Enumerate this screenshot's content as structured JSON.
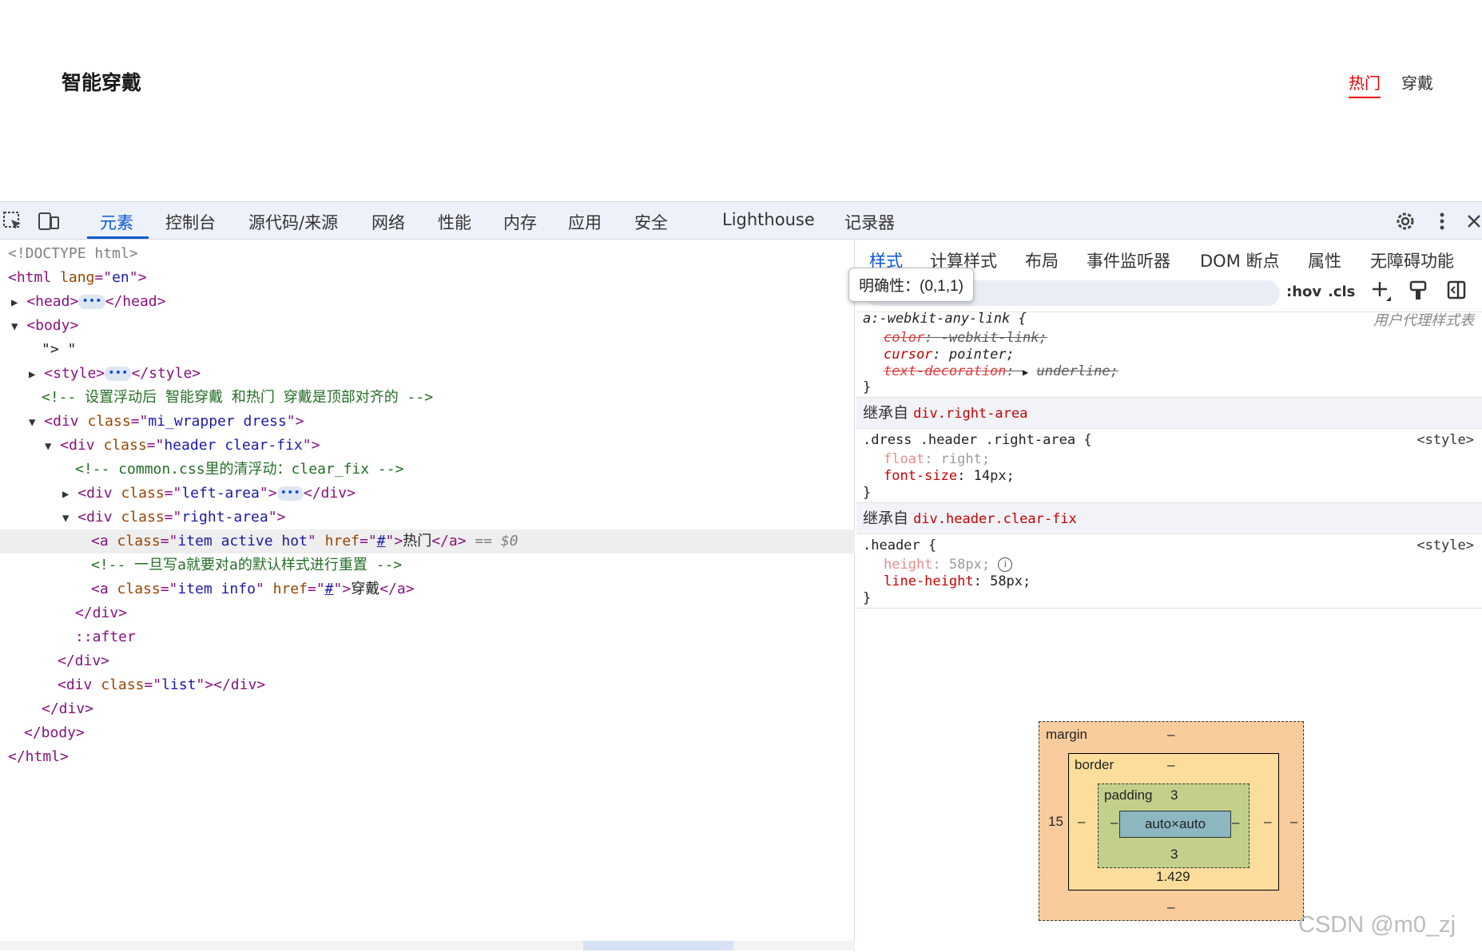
{
  "page": {
    "title": "智能穿戴",
    "nav": [
      "热门",
      "穿戴"
    ]
  },
  "devtools": {
    "tabs": [
      "元素",
      "控制台",
      "源代码/来源",
      "网络",
      "性能",
      "内存",
      "应用",
      "安全",
      "Lighthouse",
      "记录器"
    ],
    "active_tab": "元素",
    "icons": [
      "inspect-icon",
      "device-toolbar-icon",
      "gear-icon",
      "more-vert-icon",
      "close-icon"
    ]
  },
  "elements": {
    "lines": {
      "l1": "<!DOCTYPE html>",
      "l2a": "<html ",
      "l2b": "lang",
      "l2c": "=\"",
      "l2d": "en",
      "l2e": "\">",
      "l3a": "<head>",
      "l3b": "</head>",
      "l4": "<body>",
      "l5": "\"> \"",
      "l6a": "<style>",
      "l6b": "</style>",
      "l7": "<!-- 设置浮动后 智能穿戴 和热门 穿戴是顶部对齐的 -->",
      "l8a": "<div ",
      "l8b": "class",
      "l8c": "=\"",
      "l8d": "mi_wrapper dress",
      "l8e": "\">",
      "l9a": "<div ",
      "l9b": "class",
      "l9c": "=\"",
      "l9d": "header clear-fix",
      "l9e": "\">",
      "l10": "<!-- common.css里的清浮动：clear_fix -->",
      "l11a": "<div ",
      "l11b": "class",
      "l11c": "=\"",
      "l11d": "left-area",
      "l11e": "\">",
      "l11f": "</div>",
      "l12a": "<div ",
      "l12b": "class",
      "l12c": "=\"",
      "l12d": "right-area",
      "l12e": "\">",
      "l13a": "<a ",
      "l13b": "class",
      "l13c": "=\"",
      "l13d": "item active hot",
      "l13e": "\" ",
      "l13f": "href",
      "l13g": "=\"",
      "l13h": "#",
      "l13i": "\">",
      "l13j": "热门",
      "l13k": "</a>",
      "l13l": " == $0",
      "l14": "<!-- 一旦写a就要对a的默认样式进行重置 -->",
      "l15a": "<a ",
      "l15b": "class",
      "l15c": "=\"",
      "l15d": "item info",
      "l15e": "\" ",
      "l15f": "href",
      "l15g": "=\"",
      "l15h": "#",
      "l15i": "\">",
      "l15j": "穿戴",
      "l15k": "</a>",
      "l16": "</div>",
      "l17": "::after",
      "l18": "</div>",
      "l19a": "<div ",
      "l19b": "class",
      "l19c": "=\"",
      "l19d": "list",
      "l19e": "\">",
      "l19f": "</div>",
      "l20": "</div>",
      "l21": "</body>",
      "l22": "</html>"
    }
  },
  "styles": {
    "subtabs": [
      "样式",
      "计算样式",
      "布局",
      "事件监听器",
      "DOM 断点",
      "属性",
      "无障碍功能"
    ],
    "active_subtab": "样式",
    "tooltip": "明确性：(0,1,1)",
    "filter_buttons": [
      ":hov",
      ".cls"
    ],
    "rule1": {
      "selector": "a:-webkit-any-link {",
      "source": "用户代理样式表",
      "decls": [
        {
          "prop": "color",
          "val": "-webkit-link;"
        },
        {
          "prop": "cursor",
          "val": "pointer;"
        },
        {
          "prop": "text-decoration",
          "val": "underline;"
        }
      ],
      "close": "}"
    },
    "inherit1": {
      "label": "继承自",
      "from": "div.right-area"
    },
    "rule2": {
      "selector": ".dress .header .right-area {",
      "source": "<style>",
      "decls": [
        {
          "prop": "float",
          "val": "right;"
        },
        {
          "prop": "font-size",
          "val": "14px;"
        }
      ],
      "close": "}"
    },
    "inherit2": {
      "label": "继承自",
      "from": "div.header.clear-fix"
    },
    "rule3": {
      "selector": ".header {",
      "source": "<style>",
      "decls": [
        {
          "prop": "height",
          "val": "58px;"
        },
        {
          "prop": "line-height",
          "val": "58px;"
        }
      ],
      "close": "}"
    }
  },
  "box_model": {
    "margin_label": "margin",
    "margin_top": "–",
    "margin_bottom": "–",
    "margin_left": "15",
    "margin_right": "–",
    "border_label": "border",
    "border_top": "–",
    "border_bottom": "1.429",
    "border_left": "–",
    "border_right": "–",
    "padding_label": "padding",
    "padding_top": "3",
    "padding_bottom": "3",
    "padding_left": "–",
    "padding_right": "–",
    "content": "auto×auto"
  },
  "watermark": "CSDN @m0_zj"
}
